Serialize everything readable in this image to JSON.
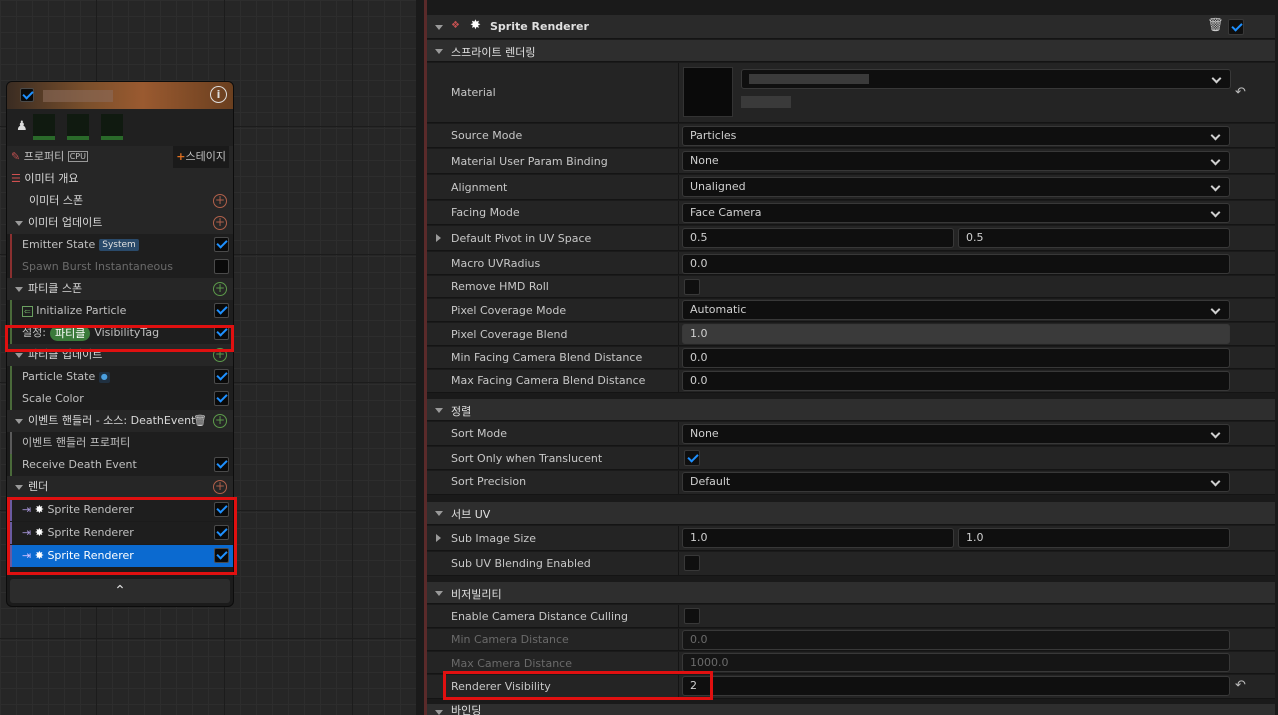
{
  "node": {
    "title_icon": "info-icon",
    "toolbar": {
      "properties_label": "프로퍼티",
      "cpu_badge": "CPU",
      "add_stage_label": "스테이지"
    },
    "emitter_summary": "이미터 개요",
    "emitter_spawn": "이미터 스폰",
    "emitter_update": "이미터 업데이트",
    "emitter_state": "Emitter State",
    "system_badge": "System",
    "spawn_burst": "Spawn Burst Instantaneous",
    "particle_spawn": "파티클 스폰",
    "initialize_particle": "Initialize Particle",
    "set_prefix": "설정:",
    "set_pill": "파티클",
    "set_name": "VisibilityTag",
    "particle_update": "파티클 업데이트",
    "particle_state": "Particle State",
    "scale_color": "Scale Color",
    "event_handler": "이벤트 핸들러 - 소스: DeathEvent",
    "event_handler_props": "이벤트 핸들러 프로퍼티",
    "receive_death": "Receive Death Event",
    "render": "렌더",
    "renderers": [
      "Sprite Renderer",
      "Sprite Renderer",
      "Sprite Renderer"
    ]
  },
  "details": {
    "header_title": "Sprite Renderer",
    "sections": {
      "sprite_rendering": "스프라이트 렌더링",
      "sorting": "정렬",
      "sub_uv": "서브 UV",
      "visibility": "비저빌리티",
      "binding": "바인딩"
    },
    "material_label": "Material",
    "source_mode": {
      "label": "Source Mode",
      "value": "Particles"
    },
    "mat_user_param": {
      "label": "Material User Param Binding",
      "value": "None"
    },
    "alignment": {
      "label": "Alignment",
      "value": "Unaligned"
    },
    "facing_mode": {
      "label": "Facing Mode",
      "value": "Face Camera"
    },
    "default_pivot": {
      "label": "Default Pivot in UV Space",
      "x": "0.5",
      "y": "0.5"
    },
    "macro_uv": {
      "label": "Macro UVRadius",
      "value": "0.0"
    },
    "remove_hmd": {
      "label": "Remove HMD Roll",
      "checked": false
    },
    "pixel_cov_mode": {
      "label": "Pixel Coverage Mode",
      "value": "Automatic"
    },
    "pixel_cov_blend": {
      "label": "Pixel Coverage Blend",
      "value": "1.0"
    },
    "min_facing": {
      "label": "Min Facing Camera Blend Distance",
      "value": "0.0"
    },
    "max_facing": {
      "label": "Max Facing Camera Blend Distance",
      "value": "0.0"
    },
    "sort_mode": {
      "label": "Sort Mode",
      "value": "None"
    },
    "sort_only_trans": {
      "label": "Sort Only when Translucent",
      "checked": true
    },
    "sort_precision": {
      "label": "Sort Precision",
      "value": "Default"
    },
    "sub_image_size": {
      "label": "Sub Image Size",
      "x": "1.0",
      "y": "1.0"
    },
    "sub_uv_blend": {
      "label": "Sub UV Blending Enabled",
      "checked": false
    },
    "enable_cam_cull": {
      "label": "Enable Camera Distance Culling",
      "checked": false
    },
    "min_cam_dist": {
      "label": "Min Camera Distance",
      "value": "0.0"
    },
    "max_cam_dist": {
      "label": "Max Camera Distance",
      "value": "1000.0"
    },
    "renderer_visibility": {
      "label": "Renderer Visibility",
      "value": "2"
    }
  }
}
